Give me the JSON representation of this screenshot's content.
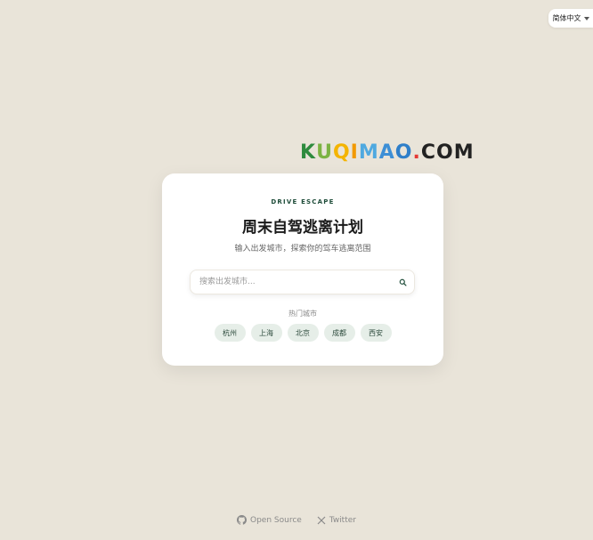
{
  "language": {
    "label": "简体中文"
  },
  "logo": {
    "letters": [
      {
        "ch": "K",
        "color": "#2e8b3e"
      },
      {
        "ch": "U",
        "color": "#7cb342"
      },
      {
        "ch": "Q",
        "color": "#f4b400"
      },
      {
        "ch": "I",
        "color": "#f29900"
      },
      {
        "ch": "M",
        "color": "#4fa9e0"
      },
      {
        "ch": "A",
        "color": "#3d8fd6"
      },
      {
        "ch": "O",
        "color": "#2f7fc9"
      },
      {
        "ch": ".",
        "color": "#e53935"
      },
      {
        "ch": "C",
        "color": "#222222"
      },
      {
        "ch": "O",
        "color": "#222222"
      },
      {
        "ch": "M",
        "color": "#222222"
      }
    ]
  },
  "card": {
    "eyebrow": "DRIVE ESCAPE",
    "title": "周末自驾逃离计划",
    "subtitle": "输入出发城市，探索你的驾车逃离范围",
    "search": {
      "placeholder": "搜索出发城市..."
    },
    "hot_label": "热门城市",
    "cities": [
      "杭州",
      "上海",
      "北京",
      "成都",
      "西安"
    ]
  },
  "footer": {
    "open_source": "Open Source",
    "twitter": "Twitter"
  }
}
